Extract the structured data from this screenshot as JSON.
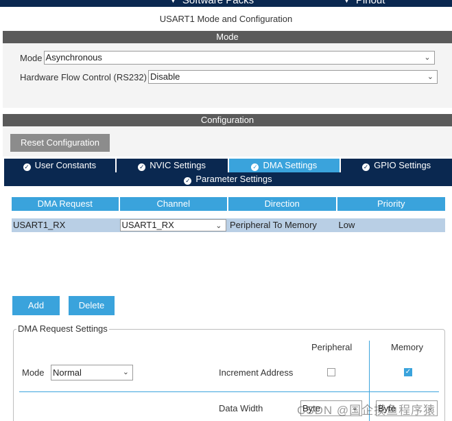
{
  "topbar": {
    "tabs": [
      {
        "label": "Software Packs",
        "icon": "chevron-down-icon"
      },
      {
        "label": "Pinout",
        "icon": "chevron-down-icon"
      }
    ]
  },
  "window_title": "USART1 Mode and Configuration",
  "mode_section": {
    "header": "Mode",
    "fields": [
      {
        "label": "Mode",
        "value": "Asynchronous"
      },
      {
        "label": "Hardware Flow Control (RS232)",
        "value": "Disable"
      }
    ]
  },
  "config_section": {
    "header": "Configuration",
    "reset_button": "Reset Configuration",
    "tabs": [
      {
        "label": "User Constants",
        "active": false
      },
      {
        "label": "NVIC Settings",
        "active": false
      },
      {
        "label": "DMA Settings",
        "active": true
      },
      {
        "label": "GPIO Settings",
        "active": false
      }
    ],
    "tab_row2": [
      {
        "label": "Parameter Settings",
        "active": false
      }
    ]
  },
  "dma_table": {
    "columns": [
      "DMA Request",
      "Channel",
      "Direction",
      "Priority"
    ],
    "rows": [
      {
        "request": "USART1_RX",
        "channel": "USART1_RX",
        "direction": "Peripheral To Memory",
        "priority": "Low"
      }
    ]
  },
  "buttons": {
    "add": "Add",
    "delete": "Delete"
  },
  "dma_request_settings": {
    "legend": "DMA Request Settings",
    "col_peripheral": "Peripheral",
    "col_memory": "Memory",
    "mode_label": "Mode",
    "mode_value": "Normal",
    "increment_address_label": "Increment Address",
    "increment_peripheral": false,
    "increment_memory": true,
    "data_width_label": "Data Width",
    "data_width_peripheral": "Byte",
    "data_width_memory": "Byte"
  },
  "watermark": "CSDN @国企摸鱼程序猿",
  "colors": {
    "dark_navy": "#0a2850",
    "accent_blue": "#3aa3dc",
    "row_selected": "#b9cfe5",
    "section_header": "#5a5a5a",
    "reset_button": "#8c8c8c"
  }
}
